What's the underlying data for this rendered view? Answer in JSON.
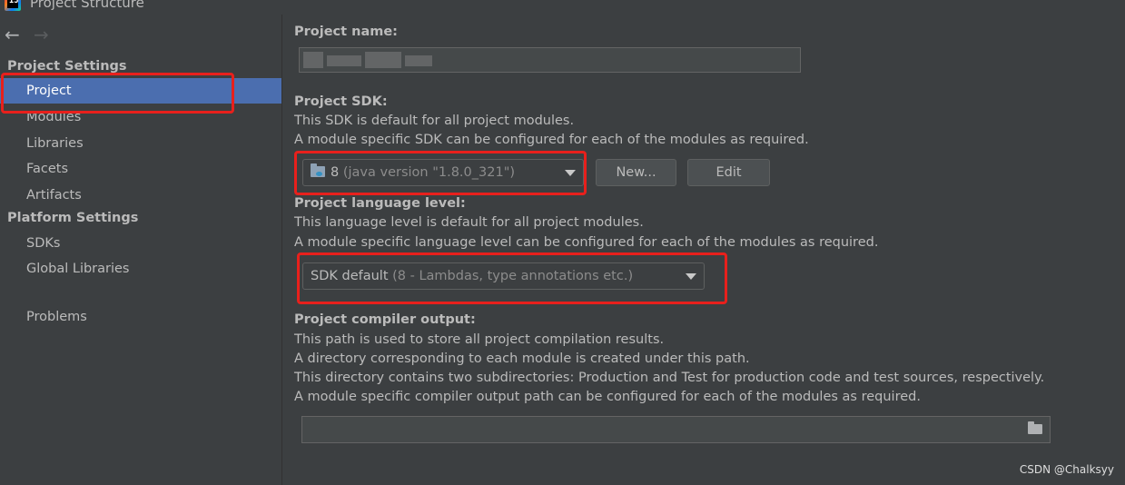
{
  "window": {
    "title": "Project Structure",
    "app_icon_glyph": "IJ"
  },
  "nav": {
    "back_glyph": "←",
    "forward_glyph": "→"
  },
  "sidebar": {
    "project_settings_header": "Project Settings",
    "platform_settings_header": "Platform Settings",
    "items": [
      {
        "label": "Project",
        "selected": true
      },
      {
        "label": "Modules"
      },
      {
        "label": "Libraries"
      },
      {
        "label": "Facets"
      },
      {
        "label": "Artifacts"
      },
      {
        "label": "SDKs"
      },
      {
        "label": "Global Libraries"
      },
      {
        "label": "Problems"
      }
    ]
  },
  "main": {
    "project_name": {
      "label": "Project name:",
      "value": ""
    },
    "sdk": {
      "label": "Project SDK:",
      "desc1": "This SDK is default for all project modules.",
      "desc2": "A module specific SDK can be configured for each of the modules as required.",
      "selected_value": "8",
      "selected_detail": "(java version \"1.8.0_321\")",
      "new_button": "New...",
      "edit_button": "Edit"
    },
    "language_level": {
      "label": "Project language level:",
      "desc1": "This language level is default for all project modules.",
      "desc2": "A module specific language level can be configured for each of the modules as required.",
      "selected_value": "SDK default",
      "selected_detail": "(8 - Lambdas, type annotations etc.)"
    },
    "compiler_output": {
      "label": "Project compiler output:",
      "desc1": "This path is used to store all project compilation results.",
      "desc2": "A directory corresponding to each module is created under this path.",
      "desc3": "This directory contains two subdirectories: Production and Test for production code and test sources, respectively.",
      "desc4": "A module specific compiler output path can be configured for each of the modules as required.",
      "value": ""
    }
  },
  "watermark": "CSDN @Chalksyy",
  "colors": {
    "background": "#3c3f41",
    "selection": "#4b6eaf",
    "highlight_annotation": "#e8201c",
    "text": "#bbbbbb"
  }
}
